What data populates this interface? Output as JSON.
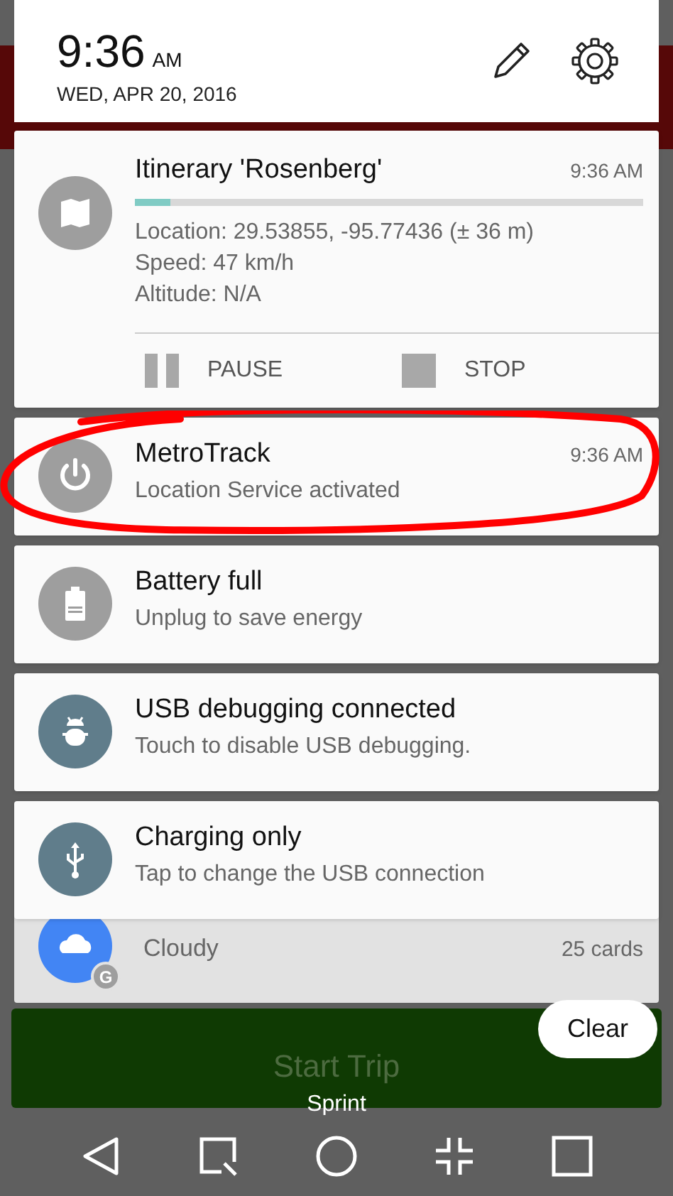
{
  "header": {
    "time": "9:36",
    "ampm": "AM",
    "date": "WED, APR 20, 2016"
  },
  "notifications": [
    {
      "kind": "progress",
      "color": "#9e9e9e",
      "title": "Itinerary 'Rosenberg'",
      "time": "9:36 AM",
      "level": 0.07,
      "lines": [
        "Location: 29.53855, -95.77436 (± 36 m)",
        "Speed: 47 km/h",
        "Altitude: N/A"
      ],
      "actions": [
        {
          "kind": "pause",
          "label": "PAUSE"
        },
        {
          "kind": "stop",
          "label": "STOP"
        }
      ],
      "circled": false
    },
    {
      "kind": "simple",
      "color": "#9e9e9e",
      "title": "MetroTrack",
      "time": "9:36 AM",
      "text": "Location Service activated",
      "circled": true
    },
    {
      "kind": "simple",
      "color": "#9e9e9e",
      "title": "Battery full",
      "text": "Unplug to save energy",
      "circled": false
    },
    {
      "kind": "simple",
      "color": "#607d8b",
      "title": "USB debugging connected",
      "text": "Touch to disable USB debugging.",
      "circled": false
    },
    {
      "kind": "simple",
      "color": "#607d8b",
      "title": "Charging only",
      "text": "Tap to change the USB connection",
      "circled": false
    }
  ],
  "weather": {
    "color": "#4285f4",
    "badge": "G",
    "text": "Cloudy",
    "count": "25 cards"
  },
  "start_button": "Start Trip",
  "carrier": "Sprint",
  "clear_button": "Clear"
}
